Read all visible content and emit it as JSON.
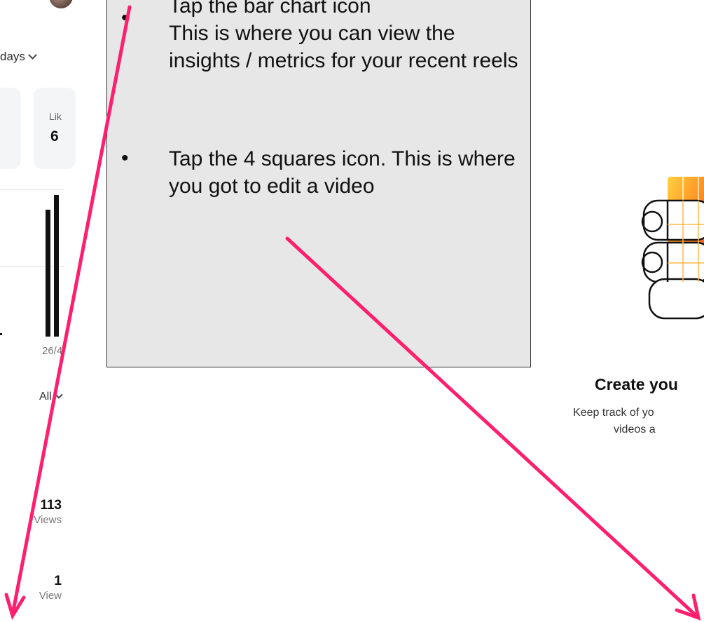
{
  "callout": {
    "items": [
      "Tap the bar chart icon",
      "This is where you can view the insights / metrics for your recent reels",
      "Tap the 4 squares icon. This is where you got to edit a video"
    ],
    "bullet": "•"
  },
  "insights": {
    "range_label": "days",
    "likes_label": "Lik",
    "likes_value": "6",
    "chart": {
      "x_tick": "26/4",
      "bar_heights_relative": [
        0.86,
        0.96
      ]
    },
    "filter_label": "All",
    "reels": [
      {
        "count": "113",
        "unit": "Views"
      },
      {
        "count": "1",
        "unit": "View"
      }
    ]
  },
  "create_panel": {
    "title": "Create you",
    "desc_line1": "Keep track of yo",
    "desc_line2": "videos a"
  },
  "colors": {
    "arrow": "#ff1f6e",
    "callout_bg": "#e7e7e7",
    "card_bg": "#f3f5f7"
  },
  "icons": {
    "chevron": "chevron-down-icon",
    "illustration": "stacked-video-grid-illustration"
  }
}
